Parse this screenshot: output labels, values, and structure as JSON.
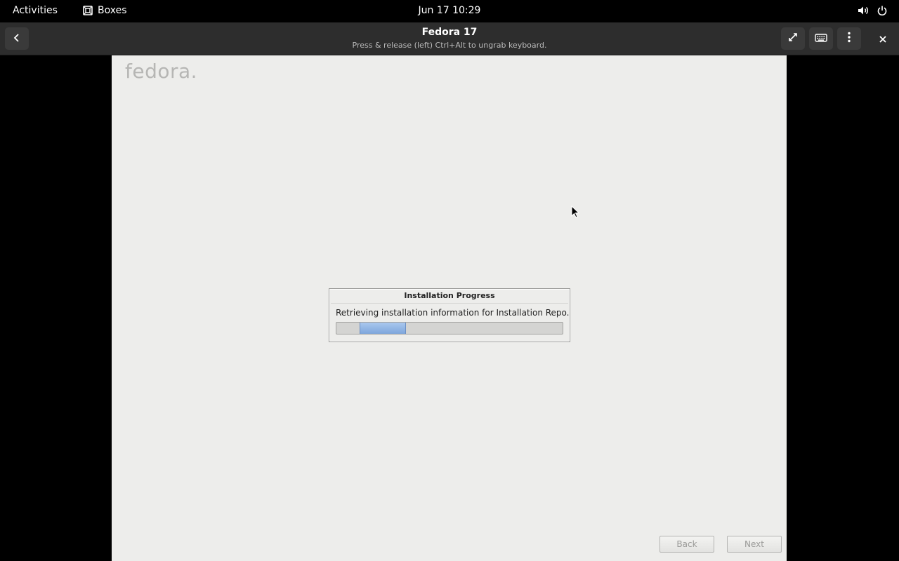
{
  "topbar": {
    "activities": "Activities",
    "app_name": "Boxes",
    "clock": "Jun 17  10:29",
    "icons": [
      "boxes-app-icon",
      "volume-icon",
      "power-icon"
    ]
  },
  "headerbar": {
    "title": "Fedora 17",
    "subtitle": "Press & release (left) Ctrl+Alt to ungrab keyboard.",
    "icons": [
      "back-arrow-icon",
      "fullscreen-icon",
      "keyboard-icon",
      "more-menu-icon",
      "close-icon"
    ]
  },
  "vm": {
    "logo_text": "fedora.",
    "dialog": {
      "title": "Installation Progress",
      "message": "Retrieving installation information for Installation Repo.",
      "progress_pulse": "indeterminate"
    },
    "buttons": {
      "back": "Back",
      "next": "Next"
    }
  },
  "colors": {
    "topbar_bg": "#000000",
    "headerbar_bg": "#2d2d2d",
    "vm_bg": "#ededeb",
    "progress_fill": "#8fb3e4"
  }
}
